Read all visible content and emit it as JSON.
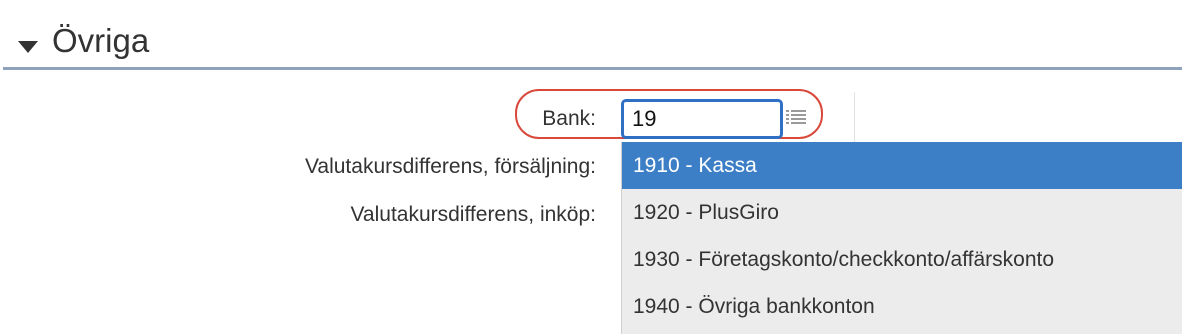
{
  "section": {
    "title": "Övriga",
    "caret_icon": "caret-down-icon"
  },
  "form": {
    "bank_label": "Bank:",
    "bank_value": "19",
    "sales_label": "Valutakursdifferens, försäljning:",
    "purchase_label": "Valutakursdifferens, inköp:",
    "list_icon": "list-icon"
  },
  "dropdown": {
    "options": [
      {
        "label": "1910 - Kassa",
        "selected": true
      },
      {
        "label": "1920 - PlusGiro",
        "selected": false
      },
      {
        "label": "1930 - Företagskonto/checkkonto/affärskonto",
        "selected": false
      },
      {
        "label": "1940 - Övriga bankkonton",
        "selected": false
      }
    ]
  },
  "colors": {
    "selected_option_bg": "#3d7fc6",
    "input_focus_border": "#2f6fc4",
    "highlight_ring": "#d9483b",
    "divider": "#8ea2bd"
  }
}
